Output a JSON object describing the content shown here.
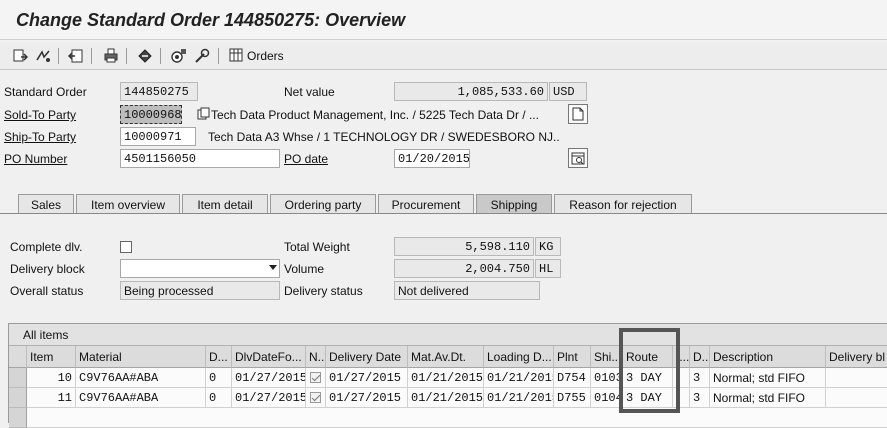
{
  "window": {
    "title": "Change Standard Order 144850275: Overview"
  },
  "toolbar": {
    "orders_label": "Orders",
    "icons": [
      "display-document-icon",
      "toggle-icon",
      "back-icon",
      "print-icon",
      "header-icon",
      "items-icon",
      "config-icon",
      "orders-icon"
    ]
  },
  "header": {
    "standard_order_label": "Standard Order",
    "standard_order_value": "144850275",
    "net_value_label": "Net value",
    "net_value": "1,085,533.60",
    "currency": "USD",
    "sold_to_label": "Sold-To Party",
    "sold_to_value": "10000968",
    "sold_to_desc": "Tech Data Product Management, Inc. / 5225 Tech Data Dr / ...",
    "ship_to_label": "Ship-To Party",
    "ship_to_value": "10000971",
    "ship_to_desc": "Tech Data A3 Whse / 1 TECHNOLOGY DR / SWEDESBORO NJ...",
    "po_number_label": "PO Number",
    "po_number_value": "4501156050",
    "po_date_label": "PO date",
    "po_date_value": "01/20/2015"
  },
  "tabs": [
    {
      "label": "Sales",
      "active": false
    },
    {
      "label": "Item overview",
      "active": false
    },
    {
      "label": "Item detail",
      "active": false
    },
    {
      "label": "Ordering party",
      "active": false
    },
    {
      "label": "Procurement",
      "active": false
    },
    {
      "label": "Shipping",
      "active": true
    },
    {
      "label": "Reason for rejection",
      "active": false
    }
  ],
  "shipping": {
    "complete_dlv_label": "Complete dlv.",
    "complete_dlv_checked": false,
    "delivery_block_label": "Delivery block",
    "delivery_block_value": "",
    "overall_status_label": "Overall status",
    "overall_status_value": "Being processed",
    "total_weight_label": "Total Weight",
    "total_weight_value": "5,598.110",
    "total_weight_unit": "KG",
    "volume_label": "Volume",
    "volume_value": "2,004.750",
    "volume_unit": "HL",
    "delivery_status_label": "Delivery status",
    "delivery_status_value": "Not delivered"
  },
  "items_table": {
    "title": "All items",
    "columns": [
      "Item",
      "Material",
      "D...",
      "DlvDateFo...",
      "N..",
      "Delivery Date",
      "Mat.Av.Dt.",
      "Loading D...",
      "Plnt",
      "Shi...",
      "Route",
      "I...",
      "D..",
      "Description",
      "Delivery bl"
    ],
    "rows": [
      {
        "item": "10",
        "material": "C9V76AA#ABA",
        "d": "0",
        "dlvdatefo": "01/27/2015",
        "n_checked": true,
        "delivery_date": "01/27/2015",
        "matavdt": "01/21/2015",
        "loading": "01/21/2015",
        "plnt": "D754",
        "shi": "0103",
        "route": "3 DAY",
        "i": "",
        "d2": "3",
        "description": "Normal; std FIFO",
        "delivery_bl": ""
      },
      {
        "item": "11",
        "material": "C9V76AA#ABA",
        "d": "0",
        "dlvdatefo": "01/27/2015",
        "n_checked": true,
        "delivery_date": "01/27/2015",
        "matavdt": "01/21/2015",
        "loading": "01/21/2015",
        "plnt": "D755",
        "shi": "0104",
        "route": "3 DAY",
        "i": "",
        "d2": "3",
        "description": "Normal; std FIFO",
        "delivery_bl": ""
      }
    ]
  }
}
